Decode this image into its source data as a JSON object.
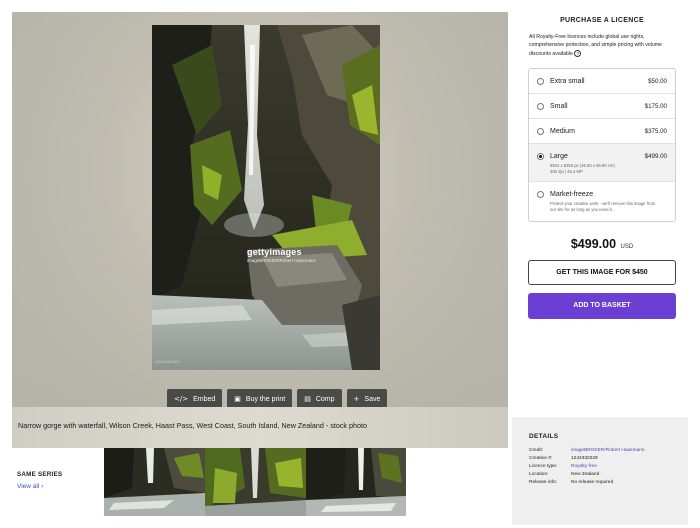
{
  "viewer": {
    "watermark_logo": "gettyimages",
    "watermark_credit": "imageBROKER/Robert Haasmann",
    "image_id": "1244332229",
    "caption": "Narrow gorge with waterfall, Wilson Creek, Haast Pass, West Coast, South Island, New Zealand - stock photo"
  },
  "actions": [
    {
      "icon": "code-icon",
      "glyph": "</>",
      "label": "Embed"
    },
    {
      "icon": "image-icon",
      "glyph": "▣",
      "label": "Buy the print"
    },
    {
      "icon": "compare-icon",
      "glyph": "▤",
      "label": "Comp"
    },
    {
      "icon": "plus-icon",
      "glyph": "+",
      "label": "Save"
    }
  ],
  "panel": {
    "title": "PURCHASE A LICENCE",
    "description": "All Royalty-Free licences include global use rights, comprehensive protection, and simple pricing with volume discounts available",
    "info_glyph": "?",
    "sizes": [
      {
        "name": "Extra small",
        "price": "$50.00",
        "selected": false
      },
      {
        "name": "Small",
        "price": "$175.00",
        "selected": false
      },
      {
        "name": "Medium",
        "price": "$375.00",
        "selected": false
      },
      {
        "name": "Large",
        "price": "$499.00",
        "selected": true,
        "sub1": "5504 x 8256 px (46.60 x 69.90 cm)",
        "sub2": "300 dpi | 45.4 MP"
      },
      {
        "name": "Market-freeze",
        "price": "",
        "selected": false,
        "sub1": "Protect your creative work - we'll remove this image from our site for as long as you need it."
      }
    ],
    "total_amount": "$499.00",
    "total_currency": "USD",
    "get_button": "GET THIS IMAGE FOR $450",
    "basket_button": "ADD TO BASKET"
  },
  "details": {
    "title": "DETAILS",
    "rows": [
      {
        "key": "Credit:",
        "value": "imageBROKER/Robert Haasmann",
        "link": true
      },
      {
        "key": "Creative #:",
        "value": "1244332229",
        "link": false
      },
      {
        "key": "Licence type:",
        "value": "Royalty-free",
        "link": true
      },
      {
        "key": "Location:",
        "value": "New Zealand",
        "link": false
      },
      {
        "key": "Release info:",
        "value": "No release required",
        "link": false
      }
    ]
  },
  "series": {
    "title": "SAME SERIES",
    "link": "View all ›"
  },
  "colors": {
    "accent_purple": "#6b3fd4",
    "link_purple": "#5a3fb8",
    "action_button_bg": "#4a4a46"
  }
}
